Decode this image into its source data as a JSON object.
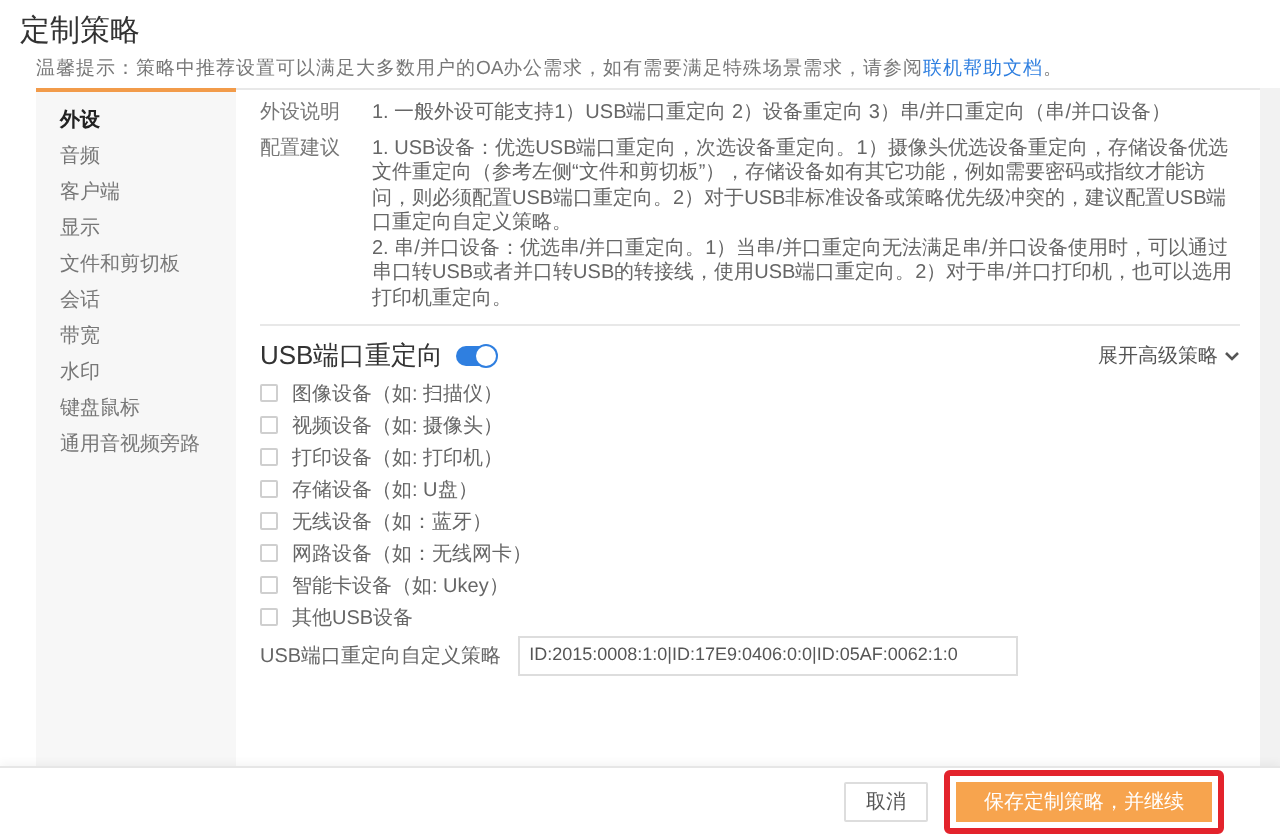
{
  "title": "定制策略",
  "notice": {
    "text": "温馨提示：策略中推荐设置可以满足大多数用户的OA办公需求，如有需要满足特殊场景需求，请参阅",
    "link": "联机帮助文档",
    "end": "。"
  },
  "sidebar": {
    "items": [
      {
        "label": "外设",
        "selected": true
      },
      {
        "label": "音频",
        "selected": false
      },
      {
        "label": "客户端",
        "selected": false
      },
      {
        "label": "显示",
        "selected": false
      },
      {
        "label": "文件和剪切板",
        "selected": false
      },
      {
        "label": "会话",
        "selected": false
      },
      {
        "label": "带宽",
        "selected": false
      },
      {
        "label": "水印",
        "selected": false
      },
      {
        "label": "键盘鼠标",
        "selected": false
      },
      {
        "label": "通用音视频旁路",
        "selected": false
      }
    ]
  },
  "description": {
    "label": "外设说明",
    "text": "1. 一般外设可能支持1）USB端口重定向 2）设备重定向 3）串/并口重定向（串/并口设备）"
  },
  "advice": {
    "label": "配置建议",
    "paragraphs": [
      "1. USB设备：优选USB端口重定向，次选设备重定向。1）摄像头优选设备重定向，存储设备优选文件重定向（参考左侧“文件和剪切板”），存储设备如有其它功能，例如需要密码或指纹才能访问，则必须配置USB端口重定向。2）对于USB非标准设备或策略优先级冲突的，建议配置USB端口重定向自定义策略。",
      "2. 串/并口设备：优选串/并口重定向。1）当串/并口重定向无法满足串/并口设备使用时，可以通过串口转USB或者并口转USB的转接线，使用USB端口重定向。2）对于串/并口打印机，也可以选用打印机重定向。"
    ]
  },
  "usb_redirect": {
    "title": "USB端口重定向",
    "on": true,
    "expand_link": "展开高级策略",
    "options": [
      {
        "label": "图像设备（如: 扫描仪）",
        "checked": false
      },
      {
        "label": "视频设备（如: 摄像头）",
        "checked": false
      },
      {
        "label": "打印设备（如: 打印机）",
        "checked": false
      },
      {
        "label": "存储设备（如: U盘）",
        "checked": false
      },
      {
        "label": "无线设备（如：蓝牙）",
        "checked": false
      },
      {
        "label": "网路设备（如：无线网卡）",
        "checked": false
      },
      {
        "label": "智能卡设备（如: Ukey）",
        "checked": false
      },
      {
        "label": "其他USB设备",
        "checked": false
      }
    ],
    "custom_policy": {
      "label": "USB端口重定向自定义策略",
      "value": "ID:2015:0008:1:0|ID:17E9:0406:0:0|ID:05AF:0062:1:0"
    }
  },
  "buttons": [
    {
      "label": "取消",
      "kind": "secondary",
      "highlighted": false
    },
    {
      "label": "保存定制策略，并继续",
      "kind": "primary",
      "highlighted": true
    }
  ]
}
